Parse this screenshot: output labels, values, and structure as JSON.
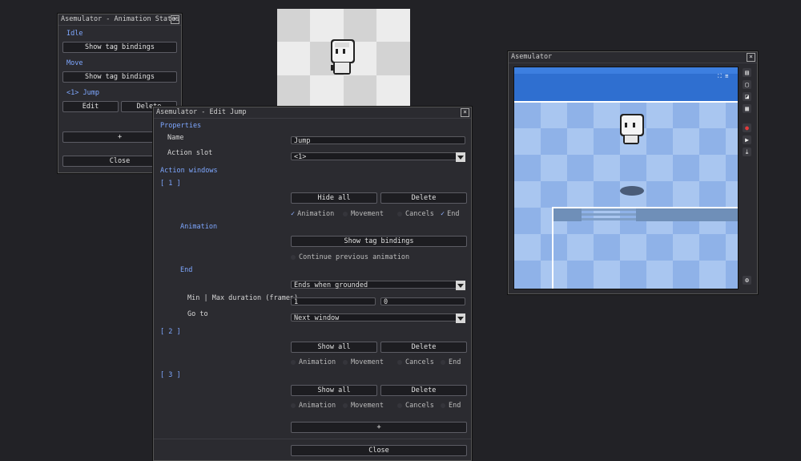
{
  "states_window": {
    "title": "Asemulator - Animation States",
    "close": "X",
    "items": [
      {
        "name": "Idle",
        "button": "Show tag bindings"
      },
      {
        "name": "Move",
        "button": "Show tag bindings"
      },
      {
        "name": "<1> Jump",
        "edit": "Edit",
        "delete": "Delete"
      }
    ],
    "add": "+",
    "close_button": "Close"
  },
  "edit_window": {
    "title": "Asemulator - Edit Jump",
    "close": "X",
    "properties": "Properties",
    "name_label": "Name",
    "name_value": "Jump",
    "slot_label": "Action slot",
    "slot_value": "<1>",
    "action_windows": "Action windows",
    "w1": {
      "heading": "[ 1 ]",
      "hide": "Hide all",
      "delete": "Delete",
      "checks": [
        {
          "label": "Animation",
          "checked": true
        },
        {
          "label": "Movement",
          "checked": false
        },
        {
          "label": "Cancels",
          "checked": false
        },
        {
          "label": "End",
          "checked": true
        }
      ],
      "animation_heading": "Animation",
      "show_tags": "Show tag bindings",
      "continue_label": "Continue previous animation",
      "end_heading": "End",
      "end_mode": "Ends when grounded",
      "minmax_label": "Min | Max duration (frames)",
      "min_value": "1",
      "max_value": "0",
      "goto_label": "Go to",
      "goto_value": "Next window"
    },
    "w2": {
      "heading": "[ 2 ]",
      "show": "Show all",
      "delete": "Delete",
      "checks": [
        {
          "label": "Animation"
        },
        {
          "label": "Movement"
        },
        {
          "label": "Cancels"
        },
        {
          "label": "End"
        }
      ]
    },
    "w3": {
      "heading": "[ 3 ]",
      "show": "Show all",
      "delete": "Delete",
      "checks": [
        {
          "label": "Animation"
        },
        {
          "label": "Movement"
        },
        {
          "label": "Cancels"
        },
        {
          "label": "End"
        }
      ]
    },
    "add": "+",
    "close_button": "Close"
  },
  "emulator_window": {
    "title": "Asemulator",
    "close": "X",
    "sidebar_icons": [
      "layers-icon",
      "export-frame-icon",
      "add-icon",
      "grid-icon",
      "record-icon",
      "play-icon",
      "download-icon"
    ],
    "settings_icon": "gear-icon"
  },
  "colors": {
    "accent_blue": "#7ea7ff",
    "record_red": "#e23b3b",
    "sky_blue": "#2f6fd0"
  }
}
